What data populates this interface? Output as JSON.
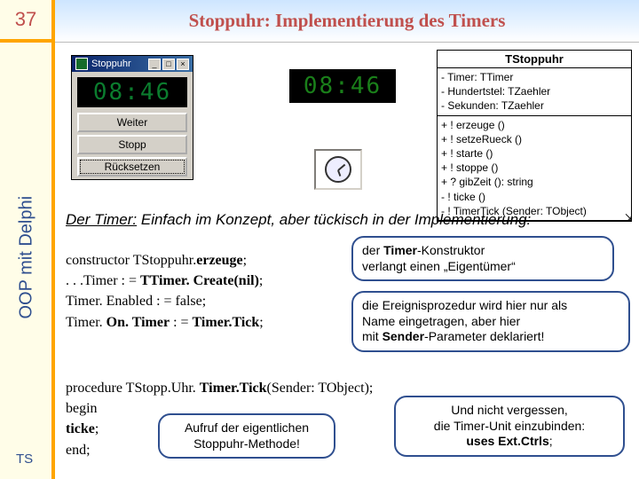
{
  "header": {
    "page_number": "37",
    "title": "Stoppuhr: Implementierung des Timers"
  },
  "sidebar": {
    "label": "OOP mit Delphi",
    "footer": "TS"
  },
  "window": {
    "title": "Stoppuhr",
    "time": "08:46",
    "buttons": {
      "resume": "Weiter",
      "stop": "Stopp",
      "reset": "Rücksetzen"
    }
  },
  "standalone_time": "08:46",
  "uml": {
    "title": "TStoppuhr",
    "attrs": [
      "- Timer: TTimer",
      "- Hundertstel: TZaehler",
      "- Sekunden: TZaehler"
    ],
    "ops": [
      "+ ! erzeuge ()",
      "+ ! setzeRueck ()",
      "+ ! starte ()",
      "+ ! stoppe ()",
      "+ ? gibZeit (): string",
      "- ! ticke ()",
      "- ! TimerTick (Sender: TObject)"
    ]
  },
  "caption": {
    "lead": "Der Timer:",
    "rest": " Einfach im Konzept, aber tückisch in der Implementierung:"
  },
  "code1": {
    "l1a": "constructor TStoppuhr.",
    "l1b": "erzeuge",
    "l1c": ";",
    "l2a": ". . .Timer : = ",
    "l2b": "TTimer. Create(nil)",
    "l2c": ";",
    "l3a": "    Timer. Enabled : = false;",
    "l4a": "    Timer. ",
    "l4b": "On. Timer",
    "l4c": " : = ",
    "l4d": "Timer.Tick",
    "l4e": ";"
  },
  "callout1": {
    "l1a": "der ",
    "l1b": "Timer",
    "l1c": "-Konstruktor",
    "l2": "verlangt einen „Eigentümer“"
  },
  "callout2": {
    "l1": "die Ereignisprozedur wird hier nur als",
    "l2": "Name eingetragen, aber hier",
    "l3a": "   mit ",
    "l3b": "Sender",
    "l3c": "-Parameter deklariert!"
  },
  "code2": {
    "l1a": "procedure TStopp.Uhr. ",
    "l1b": "Timer.Tick",
    "l1c": "(Sender: TObject);",
    "l2": "begin",
    "l3a": "    ",
    "l3b": "ticke",
    "l3c": ";",
    "l4": "end;"
  },
  "callout3": {
    "l1": "Aufruf der eigentlichen",
    "l2": "Stoppuhr-Methode!"
  },
  "callout4": {
    "l1": "Und nicht vergessen,",
    "l2": "die Timer-Unit einzubinden:",
    "l3a": "uses Ext.Ctrls",
    "l3b": ";"
  }
}
